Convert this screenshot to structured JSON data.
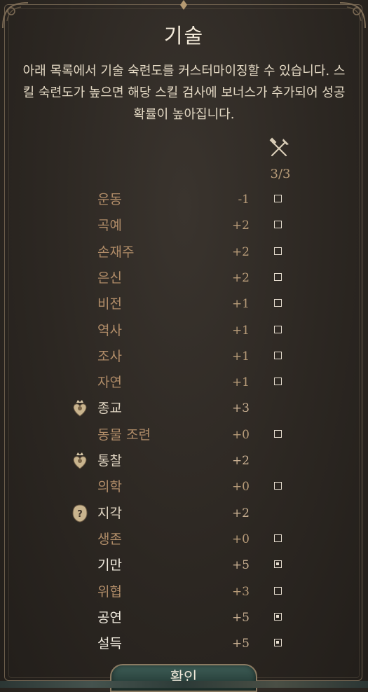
{
  "dialog": {
    "title": "기술",
    "description": "아래 목록에서 기술 숙련도를 커스터마이징할 수 있습니다. 스킬 숙련도가 높으면 해당 스킬 검사에 보너스가 추가되어 성공 확률이 높아집니다.",
    "proficiency_icon": "crossed-hammer-axe-icon",
    "proficiency_count": "3/3",
    "confirm_label": "확인"
  },
  "colors": {
    "background": "#2c2722",
    "text_normal": "#b08c68",
    "text_selected": "#f2ece0",
    "button": "#2f4a44",
    "frame": "#6d5f4d"
  },
  "skills": [
    {
      "name": "운동",
      "modifier": "-1",
      "checkbox": "unchecked"
    },
    {
      "name": "곡예",
      "modifier": "+2",
      "checkbox": "unchecked"
    },
    {
      "name": "손재주",
      "modifier": "+2",
      "checkbox": "unchecked"
    },
    {
      "name": "은신",
      "modifier": "+2",
      "checkbox": "unchecked"
    },
    {
      "name": "비전",
      "modifier": "+1",
      "checkbox": "unchecked"
    },
    {
      "name": "역사",
      "modifier": "+1",
      "checkbox": "unchecked"
    },
    {
      "name": "조사",
      "modifier": "+1",
      "checkbox": "unchecked"
    },
    {
      "name": "자연",
      "modifier": "+1",
      "checkbox": "unchecked"
    },
    {
      "name": "종교",
      "modifier": "+3",
      "checkbox": "none",
      "badge": "heart-crown-icon"
    },
    {
      "name": "동물 조련",
      "modifier": "+0",
      "checkbox": "unchecked"
    },
    {
      "name": "통찰",
      "modifier": "+2",
      "checkbox": "none",
      "badge": "heart-crown-icon"
    },
    {
      "name": "의학",
      "modifier": "+0",
      "checkbox": "unchecked"
    },
    {
      "name": "지각",
      "modifier": "+2",
      "checkbox": "none",
      "badge": "question-shield-icon"
    },
    {
      "name": "생존",
      "modifier": "+0",
      "checkbox": "unchecked"
    },
    {
      "name": "기만",
      "modifier": "+5",
      "checkbox": "checked"
    },
    {
      "name": "위협",
      "modifier": "+3",
      "checkbox": "unchecked"
    },
    {
      "name": "공연",
      "modifier": "+5",
      "checkbox": "checked"
    },
    {
      "name": "설득",
      "modifier": "+5",
      "checkbox": "checked"
    }
  ]
}
